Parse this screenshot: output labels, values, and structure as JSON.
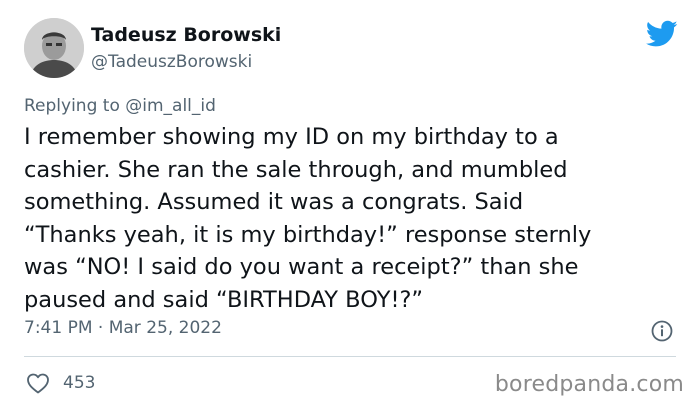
{
  "author": {
    "name": "Tadeusz Borowski",
    "handle": "@TadeuszBorowski"
  },
  "reply_prefix": "Replying to ",
  "reply_to": "@im_all_id",
  "tweet_text": "I remember showing my ID on my birthday to a\ncashier. She ran the sale through, and mumbled\nsomething. Assumed it was a congrats. Said\n“Thanks yeah, it is my birthday!” response sternly\nwas “NO! I said do you want a receipt?” than she\npaused and said “BIRTHDAY BOY!?”",
  "timestamp": "7:41 PM · Mar 25, 2022",
  "likes": "453",
  "watermark": "boredpanda.com",
  "icons": {
    "brand": "twitter-bird-icon",
    "info": "info-icon",
    "like": "heart-icon"
  },
  "colors": {
    "twitter_blue": "#1d9bf0",
    "secondary_text": "#536471",
    "primary_text": "#0f1419"
  }
}
